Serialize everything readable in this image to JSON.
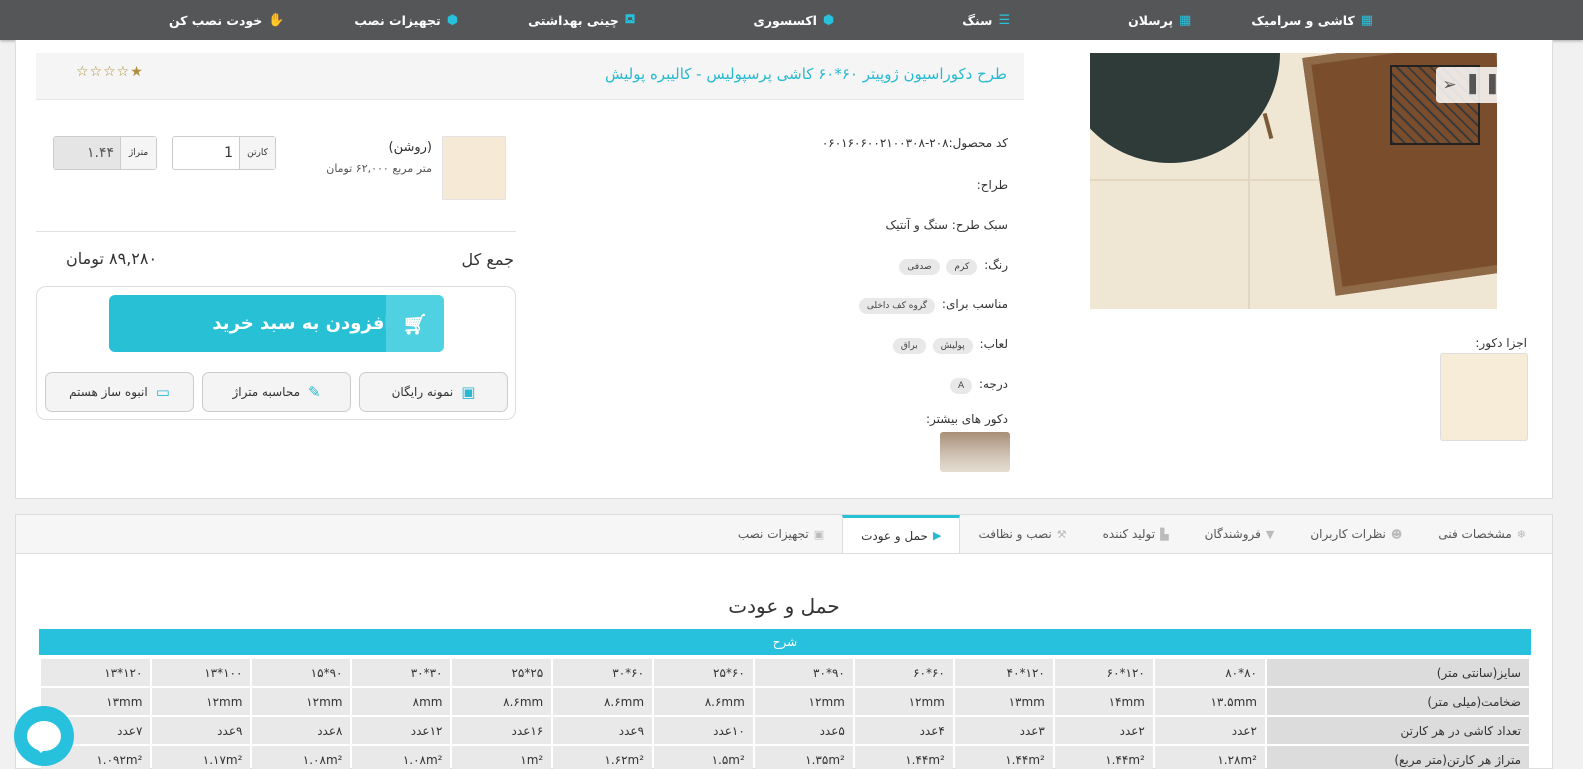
{
  "nav": {
    "items": [
      {
        "label": "کاشی و سرامیک",
        "icon": "grid-icon"
      },
      {
        "label": "پرسلان",
        "icon": "tiles-icon"
      },
      {
        "label": "سنگ",
        "icon": "stone-icon"
      },
      {
        "label": "اکسسوری",
        "icon": "hexagon-icon"
      },
      {
        "label": "چینی بهداشتی",
        "icon": "bathtub-icon"
      },
      {
        "label": "تجهیزات نصب",
        "icon": "hexagon-icon"
      },
      {
        "label": "خودت نصب کن",
        "icon": "hand-icon"
      }
    ]
  },
  "product": {
    "title": "طرح دکوراسیون ژوپیتر ۶۰*۶۰ کاشی پرسپولیس - کالیبره پولیش",
    "stars": "☆☆☆☆★",
    "code": "کد محصول:۲۰۸-۰۶۰۱۶۰۶۰۰۲۱۰۰۳۰۸",
    "designer": "طراح:",
    "style": "سبک طرح: سنگ و آنتیک",
    "color_label": "رنگ:",
    "colors": [
      "کرم",
      "صدفی"
    ],
    "suitable_label": "مناسب برای:",
    "suitable": [
      "گروه کف داخلی"
    ],
    "glaze_label": "لعاب:",
    "glazes": [
      "پولیش",
      "براق"
    ],
    "grade_label": "درجه:",
    "grade": "A",
    "more_decors_label": "دکور های بیشتر:",
    "decor_parts_label": "اجزا دکور:"
  },
  "variant": {
    "name": "(روشن)",
    "price": "متر مربع ۶۲,۰۰۰ تومان",
    "carton_label": "کارتن",
    "carton_value": "1",
    "meter_label": "متراژ",
    "meter_value": "۱.۴۴"
  },
  "summary": {
    "label": "جمع کل",
    "value": "۸۹,۲۸۰ تومان"
  },
  "buttons": {
    "add_to_cart": "افزودن به سبد خرید",
    "free_sample": "نمونه رایگان",
    "calculator": "محاسبه متراژ",
    "bulk": "انبوه ساز هستم"
  },
  "tabs": [
    {
      "label": "مشخصات فنی",
      "icon": "snowflake-icon",
      "active": false
    },
    {
      "label": "نظرات کاربران",
      "icon": "users-icon",
      "active": false
    },
    {
      "label": "فروشندگان",
      "icon": "cart-icon",
      "active": false
    },
    {
      "label": "تولید کننده",
      "icon": "factory-icon",
      "active": false
    },
    {
      "label": "نصب و نظافت",
      "icon": "wrench-icon",
      "active": false
    },
    {
      "label": "حمل و عودت",
      "icon": "truck-icon",
      "active": true
    },
    {
      "label": "تجهیزات نصب",
      "icon": "briefcase-icon",
      "active": false
    }
  ],
  "shipping": {
    "title": "حمل و عودت",
    "table_header": "شرح",
    "rows": [
      {
        "label": "سایز(سانتی متر)",
        "cells": [
          "۸۰*۸۰",
          "۱۲۰*۶۰",
          "۱۲۰*۴۰",
          "۶۰*۶۰",
          "۹۰*۳۰",
          "۶۰*۲۵",
          "۶۰*۳۰",
          "۲۵*۲۵",
          "۳۰*۳۰",
          "۹۰*۱۵",
          "۱۰۰*۱۳",
          "۱۲۰*۱۳"
        ]
      },
      {
        "label": "ضخامت(میلی متر)",
        "cells": [
          "۱۳.۵mm",
          "۱۴mm",
          "۱۳mm",
          "۱۲mm",
          "۱۲mm",
          "۸.۶mm",
          "۸.۶mm",
          "۸.۶mm",
          "۸mm",
          "۱۲mm",
          "۱۲mm",
          "۱۳mm"
        ]
      },
      {
        "label": "تعداد کاشی در هر کارتن",
        "cells": [
          "۲عدد",
          "۲عدد",
          "۳عدد",
          "۴عدد",
          "۵عدد",
          "۱۰عدد",
          "۹عدد",
          "۱۶عدد",
          "۱۲عدد",
          "۸عدد",
          "۹عدد",
          "۷عدد"
        ]
      },
      {
        "label": "متراژ هر کارتن(متر مربع)",
        "cells": [
          "۱.۲۸m²",
          "۱.۴۴m²",
          "۱.۴۴m²",
          "۱.۴۴m²",
          "۱.۳۵m²",
          "۱.۵m²",
          "۱.۶۲m²",
          "۱m²",
          "۱.۰۸m²",
          "۱.۰۸m²",
          "۱.۱۷m²",
          "۱.۰۹۲m²"
        ]
      }
    ]
  }
}
